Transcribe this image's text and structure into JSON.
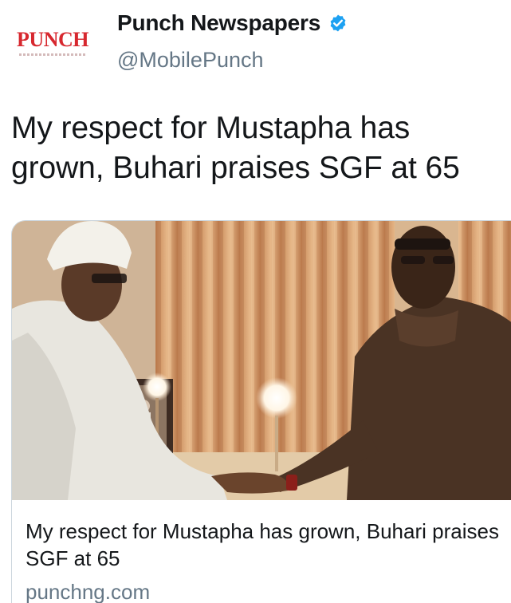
{
  "tweet": {
    "author": {
      "display_name": "Punch Newspapers",
      "handle": "@MobilePunch",
      "verified": true,
      "avatar_logo_text": "PUNCH",
      "avatar_icon": "punch-logo-icon",
      "verified_icon": "verified-badge-icon"
    },
    "text": "My respect for Mustapha has grown, Buhari praises SGF at 65",
    "card": {
      "image_icon": "article-photo",
      "title": "My respect for Mustapha has grown, Buhari praises SGF at 65",
      "domain": "punchng.com"
    }
  },
  "colors": {
    "brand_red": "#d7282f",
    "verified_blue": "#1da1f2",
    "secondary_text": "#657786",
    "border": "#ccd6dd"
  }
}
